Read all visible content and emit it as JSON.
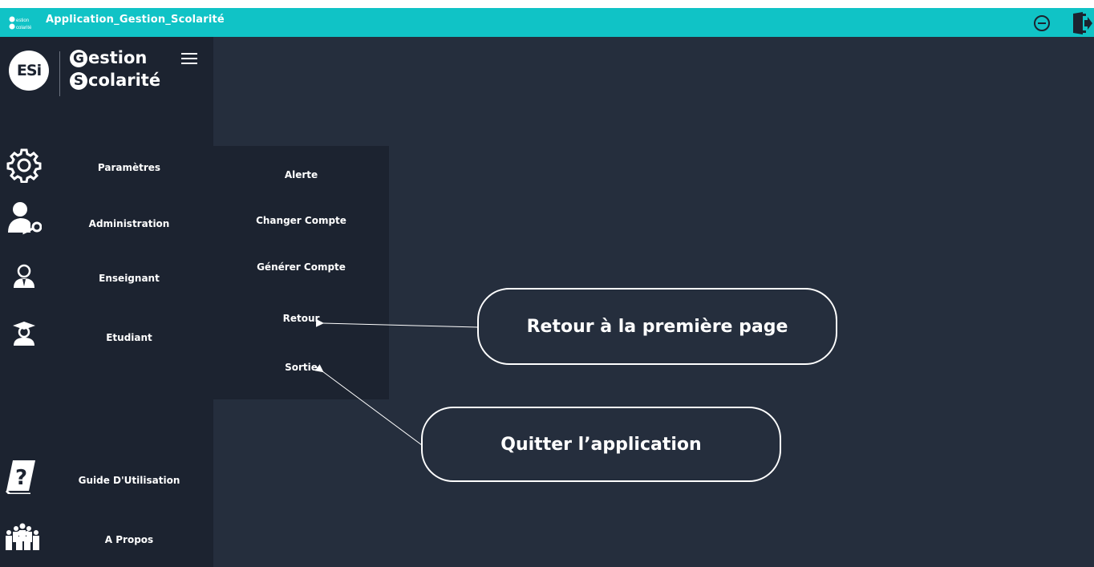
{
  "titlebar": {
    "logo_text_line1": "estion",
    "logo_text_line2": "colarité",
    "title": "Application_Gestion_Scolarité",
    "minimize_icon": "minus-circle-icon",
    "exit_icon": "door-exit-icon",
    "background": "#10c3c6"
  },
  "logo": {
    "badge": "ESi",
    "line1_cap": "G",
    "line1_rest": "estion",
    "line2_cap": "S",
    "line2_rest": "colarité",
    "menu_icon": "hamburger-icon"
  },
  "sidebar": {
    "items": [
      {
        "label": "Paramètres",
        "icon": "gear-icon"
      },
      {
        "label": "Administration",
        "icon": "admin-user-key-icon"
      },
      {
        "label": "Enseignant",
        "icon": "teacher-icon"
      },
      {
        "label": "Etudiant",
        "icon": "graduate-student-icon"
      },
      {
        "label": "Guide D'Utilisation",
        "icon": "help-book-icon"
      },
      {
        "label": "A Propos",
        "icon": "group-people-icon"
      }
    ]
  },
  "submenu": {
    "items": [
      {
        "label": "Alerte"
      },
      {
        "label": "Changer Compte"
      },
      {
        "label": "Générer Compte"
      },
      {
        "label": "Retour"
      },
      {
        "label": "Sortie"
      }
    ]
  },
  "callouts": {
    "retour": "Retour à la première page",
    "sortie": "Quitter l’application"
  },
  "colors": {
    "sidebar": "#1c2330",
    "main": "#252e3d",
    "accent": "#10c3c6"
  }
}
